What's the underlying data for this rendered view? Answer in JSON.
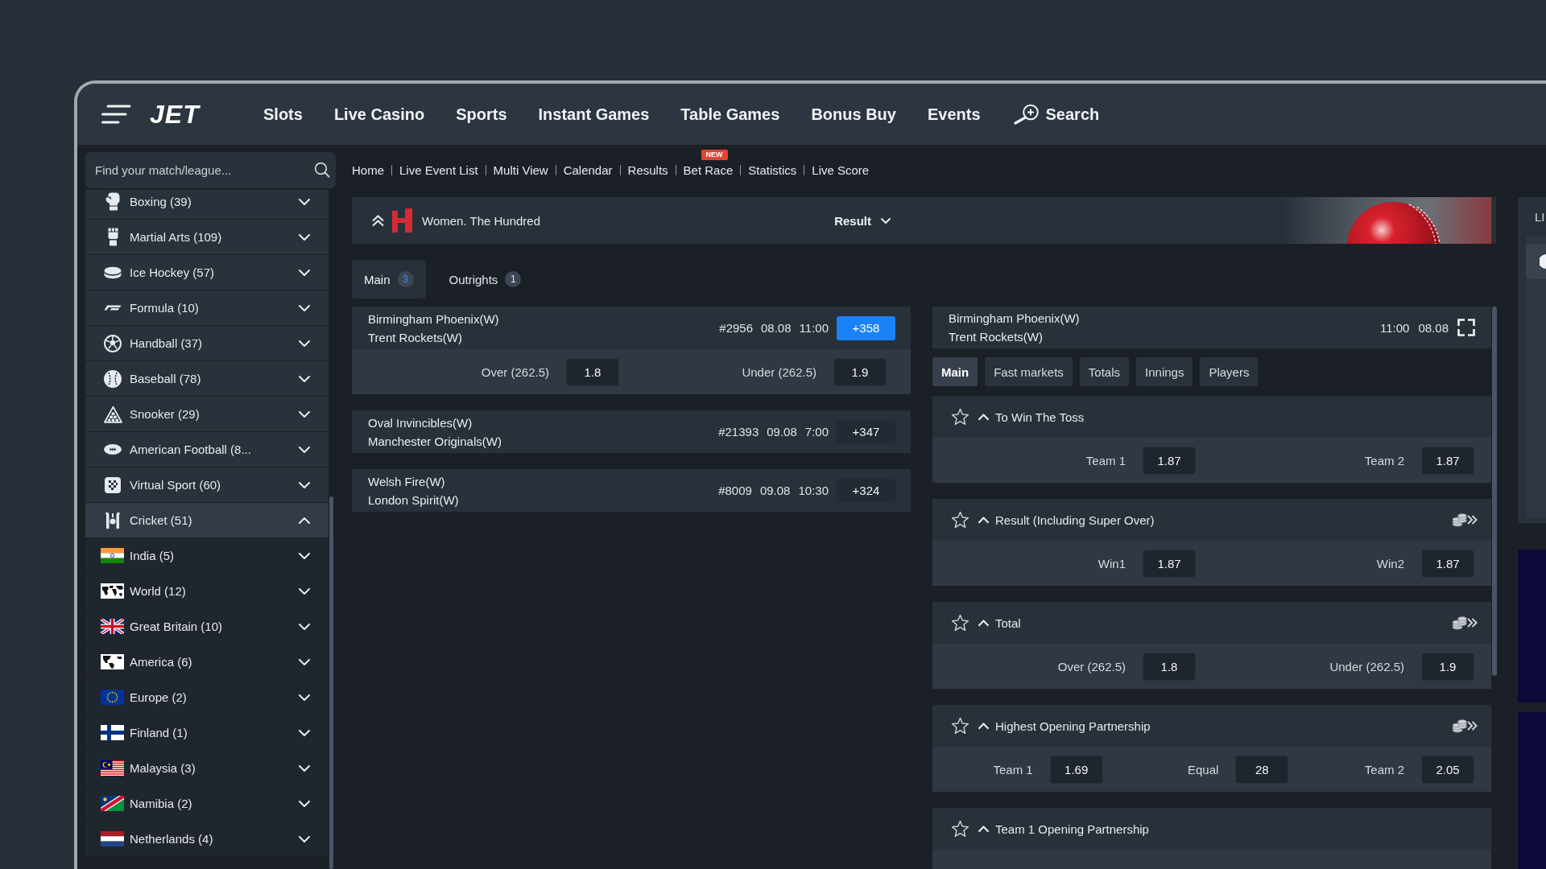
{
  "header": {
    "logo": "JET",
    "nav_items": [
      {
        "label": "Slots"
      },
      {
        "label": "Live Casino"
      },
      {
        "label": "Sports"
      },
      {
        "label": "Instant Games"
      },
      {
        "label": "Table Games"
      },
      {
        "label": "Bonus Buy"
      },
      {
        "label": "Events"
      }
    ],
    "search_label": "Search"
  },
  "finder": {
    "placeholder": "Find your match/league..."
  },
  "breadcrumbs": [
    {
      "label": "Home"
    },
    {
      "label": "Live Event List"
    },
    {
      "label": "Multi View"
    },
    {
      "label": "Calendar"
    },
    {
      "label": "Results"
    },
    {
      "label": "Bet Race",
      "badge": "NEW"
    },
    {
      "label": "Statistics"
    },
    {
      "label": "Live Score"
    }
  ],
  "sidebar": {
    "items": [
      {
        "label": "Boxing (39)",
        "expanded": false
      },
      {
        "label": "Martial Arts (109)",
        "expanded": false
      },
      {
        "label": "Ice Hockey (57)",
        "expanded": false
      },
      {
        "label": "Formula (10)",
        "expanded": false
      },
      {
        "label": "Handball (37)",
        "expanded": false
      },
      {
        "label": "Baseball (78)",
        "expanded": false
      },
      {
        "label": "Snooker (29)",
        "expanded": false
      },
      {
        "label": "American Football (8...",
        "expanded": false
      },
      {
        "label": "Virtual Sport (60)",
        "expanded": false
      },
      {
        "label": "Cricket (51)",
        "expanded": true,
        "children": [
          {
            "label": "India (5)",
            "expanded": false
          },
          {
            "label": "World (12)",
            "expanded": false
          },
          {
            "label": "Great Britain (10)",
            "expanded": false
          },
          {
            "label": "America (6)",
            "expanded": false
          },
          {
            "label": "Europe (2)",
            "expanded": false
          },
          {
            "label": "Finland (1)",
            "expanded": false
          },
          {
            "label": "Malaysia (3)",
            "expanded": false
          },
          {
            "label": "Namibia (2)",
            "expanded": false
          },
          {
            "label": "Netherlands (4)",
            "expanded": false
          }
        ]
      }
    ]
  },
  "league": {
    "title": "Women. The Hundred",
    "expanded": true,
    "sort": "Result"
  },
  "tabs": [
    {
      "label": "Main",
      "count": "3",
      "selected": true
    },
    {
      "label": "Outrights",
      "count": "1",
      "selected": false
    }
  ],
  "matches": [
    {
      "team_1": "Birmingham Phoenix(W)",
      "team_2": "Trent Rockets(W)",
      "number": "#2956",
      "date": "08.08",
      "time": "11:00",
      "more": "+358",
      "selected": true,
      "expanded": true,
      "odds": [
        {
          "label": "Over (262.5)",
          "value": "1.8"
        },
        {
          "label": "Under (262.5)",
          "value": "1.9"
        }
      ]
    },
    {
      "team_1": "Oval Invincibles(W)",
      "team_2": "Manchester Originals(W)",
      "number": "#21393",
      "date": "09.08",
      "time": "7:00",
      "more": "+347",
      "selected": false,
      "expanded": false
    },
    {
      "team_1": "Welsh Fire(W)",
      "team_2": "London Spirit(W)",
      "number": "#8009",
      "date": "09.08",
      "time": "10:30",
      "more": "+324",
      "selected": false,
      "expanded": false
    }
  ],
  "event": {
    "team_1": "Birmingham Phoenix(W)",
    "team_2": "Trent Rockets(W)",
    "time": "11:00",
    "date": "08.08",
    "tabs": [
      {
        "label": "Main",
        "selected": true
      },
      {
        "label": "Fast markets",
        "selected": false
      },
      {
        "label": "Totals",
        "selected": false
      },
      {
        "label": "Innings",
        "selected": false
      },
      {
        "label": "Players",
        "selected": false
      }
    ],
    "markets": [
      {
        "title": "To Win The Toss",
        "favorite": false,
        "expanded": true,
        "coins_badge": false,
        "outcomes": [
          {
            "label": "Team 1",
            "value": "1.87"
          },
          {
            "label": "Team 2",
            "value": "1.87"
          }
        ]
      },
      {
        "title": "Result (Including Super Over)",
        "favorite": false,
        "expanded": true,
        "coins_badge": true,
        "outcomes": [
          {
            "label": "Win1",
            "value": "1.87"
          },
          {
            "label": "Win2",
            "value": "1.87"
          }
        ]
      },
      {
        "title": "Total",
        "favorite": false,
        "expanded": true,
        "coins_badge": true,
        "outcomes": [
          {
            "label": "Over (262.5)",
            "value": "1.8"
          },
          {
            "label": "Under (262.5)",
            "value": "1.9"
          }
        ]
      },
      {
        "title": "Highest Opening Partnership",
        "favorite": false,
        "expanded": true,
        "coins_badge": true,
        "outcomes": [
          {
            "label": "Team 1",
            "value": "1.69"
          },
          {
            "label": "Equal",
            "value": "28"
          },
          {
            "label": "Team 2",
            "value": "2.05"
          }
        ]
      },
      {
        "title": "Team 1 Opening Partnership",
        "favorite": false,
        "expanded": true,
        "coins_badge": false
      }
    ]
  },
  "side_panel": {
    "title": "LI"
  }
}
